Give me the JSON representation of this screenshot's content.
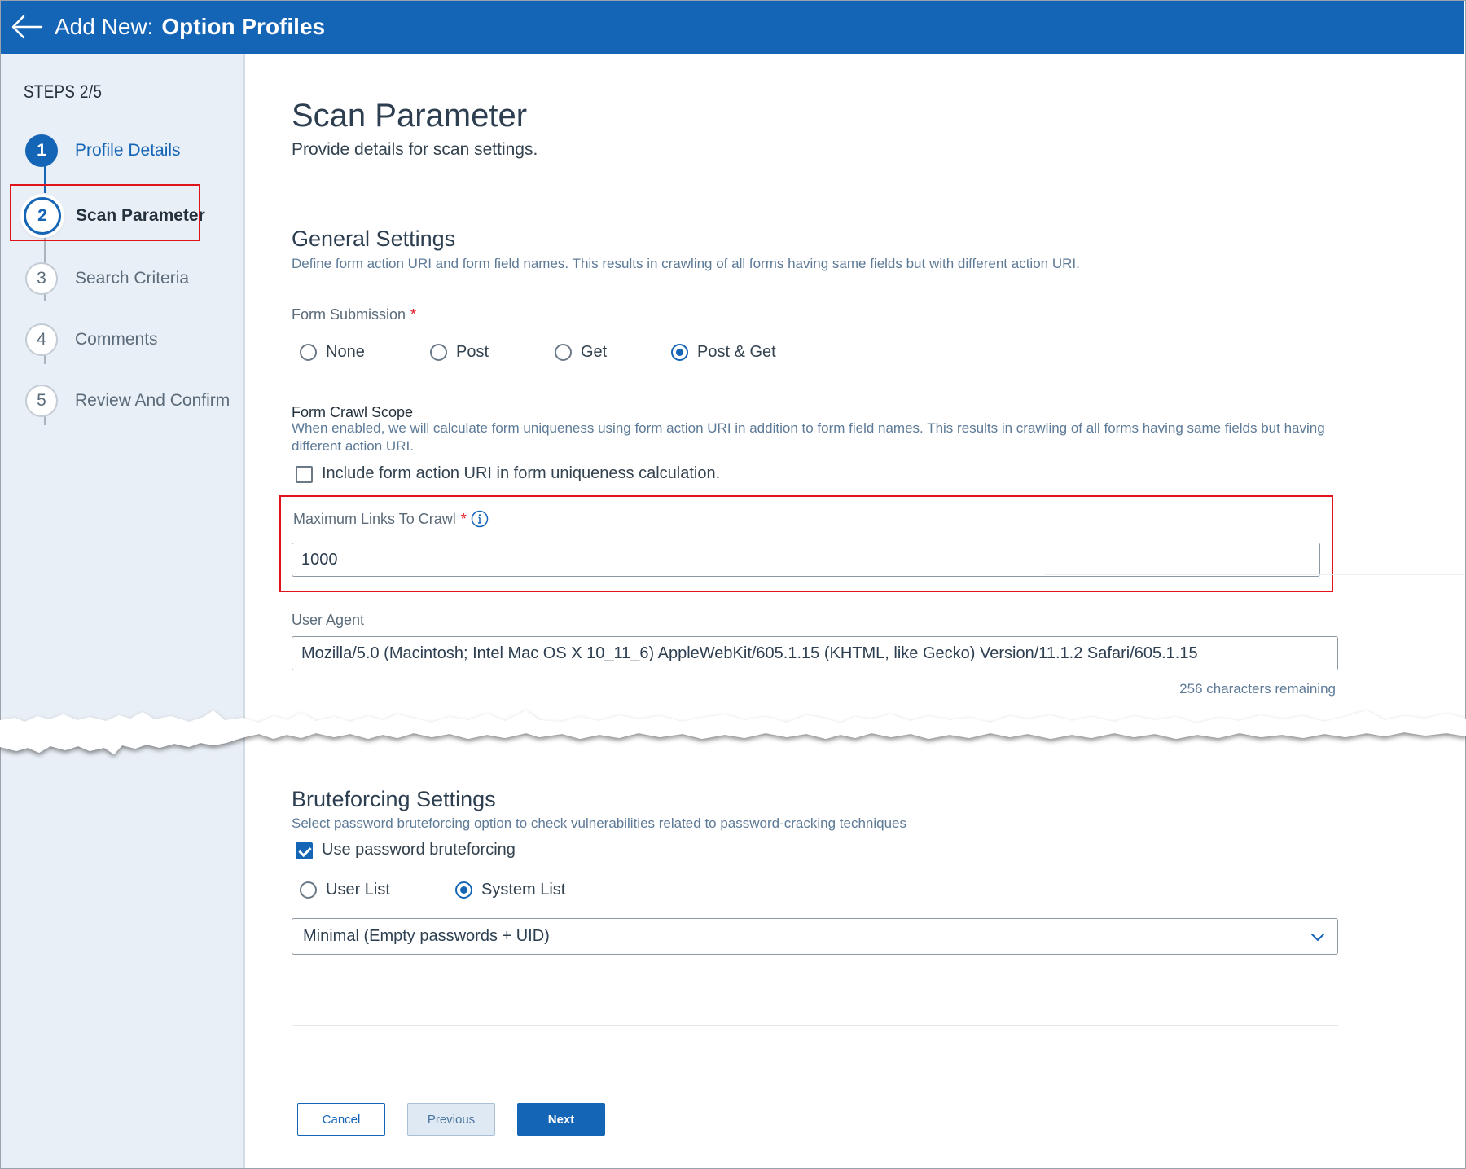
{
  "header": {
    "prefix": "Add New:",
    "title": "Option Profiles"
  },
  "sidebar": {
    "steps_label": "STEPS 2/5",
    "steps": [
      {
        "number": "1",
        "label": "Profile Details",
        "state": "done"
      },
      {
        "number": "2",
        "label": "Scan Parameter",
        "state": "active"
      },
      {
        "number": "3",
        "label": "Search Criteria",
        "state": "pending"
      },
      {
        "number": "4",
        "label": "Comments",
        "state": "pending"
      },
      {
        "number": "5",
        "label": "Review And Confirm",
        "state": "pending"
      }
    ]
  },
  "page": {
    "title": "Scan Parameter",
    "subtitle": "Provide details for scan settings."
  },
  "general": {
    "title": "General Settings",
    "description": "Define form action URI and form field names. This results in crawling of all forms having same fields but with different action URI.",
    "form_submission": {
      "label": "Form Submission",
      "required_mark": "*",
      "options": [
        "None",
        "Post",
        "Get",
        "Post & Get"
      ],
      "selected": "Post & Get"
    },
    "crawl_scope": {
      "title": "Form Crawl Scope",
      "description": "When enabled, we will calculate form uniqueness using form action URI in addition to form field names. This results in crawling of all forms having same fields but having different action URI.",
      "checkbox_label": "Include form action URI in form uniqueness calculation.",
      "checked": false
    },
    "max_links": {
      "label": "Maximum Links To Crawl",
      "required_mark": "*",
      "value": "1000"
    },
    "user_agent": {
      "label": "User Agent",
      "value": "Mozilla/5.0 (Macintosh; Intel Mac OS X 10_11_6) AppleWebKit/605.1.15 (KHTML, like Gecko) Version/11.1.2 Safari/605.1.15",
      "remaining": "256 characters remaining"
    }
  },
  "bruteforcing": {
    "title": "Bruteforcing Settings",
    "description": "Select password bruteforcing option to check vulnerabilities related to password-cracking techniques",
    "checkbox_label": "Use password bruteforcing",
    "checked": true,
    "list_options": [
      "User List",
      "System List"
    ],
    "selected_list": "System List",
    "select_value": "Minimal (Empty passwords + UID)"
  },
  "buttons": {
    "cancel": "Cancel",
    "previous": "Previous",
    "next": "Next"
  },
  "colors": {
    "brand": "#1565b7",
    "highlight": "#e0121a",
    "sidebar": "#e9eff6"
  }
}
